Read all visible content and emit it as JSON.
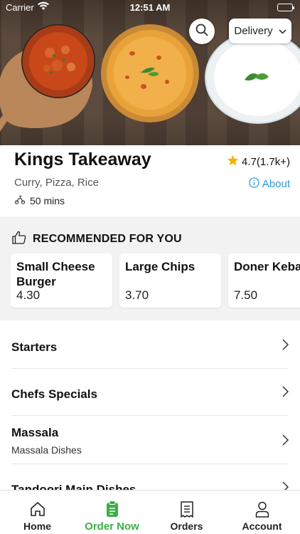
{
  "status_bar": {
    "carrier": "Carrier",
    "time": "12:51 AM"
  },
  "header": {
    "order_type": "Delivery"
  },
  "restaurant": {
    "name": "Kings Takeaway",
    "rating": "4.7(1.7k+)",
    "cuisines": "Curry, Pizza, Rice",
    "about_label": "About",
    "delivery_time": "50 mins"
  },
  "recommended": {
    "title": "RECOMMENDED FOR YOU",
    "items": [
      {
        "name": "Small Cheese Burger",
        "price": "4.30"
      },
      {
        "name": "Large Chips",
        "price": "3.70"
      },
      {
        "name": "Doner Kebab",
        "price": "7.50"
      }
    ]
  },
  "categories": [
    {
      "title": "Starters",
      "subtitle": ""
    },
    {
      "title": "Chefs Specials",
      "subtitle": ""
    },
    {
      "title": "Massala",
      "subtitle": "Massala Dishes"
    },
    {
      "title": "Tandoori Main Dishes",
      "subtitle": ""
    }
  ],
  "nav": {
    "items": [
      {
        "label": "Home"
      },
      {
        "label": "Order Now"
      },
      {
        "label": "Orders"
      },
      {
        "label": "Account"
      }
    ],
    "active_index": 1
  },
  "colors": {
    "accent_green": "#3fae49",
    "link_blue": "#2a9bd6",
    "star": "#f5b301"
  },
  "icons": [
    "search-icon",
    "chevron-down-icon",
    "star-icon",
    "info-icon",
    "scooter-icon",
    "thumbs-up-icon",
    "chevron-right-icon",
    "home-icon",
    "order-icon",
    "receipt-icon",
    "user-icon"
  ]
}
